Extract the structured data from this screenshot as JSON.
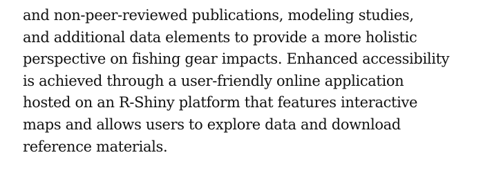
{
  "document": {
    "paragraph_lines": [
      "and non-peer-reviewed publications, modeling studies,",
      "and additional data elements to provide a more holistic",
      "perspective on fishing gear impacts. Enhanced accessibility",
      "is achieved through a user-friendly online application",
      "hosted on an R-Shiny platform that features interactive",
      "maps and allows users to explore data and download",
      "reference materials."
    ]
  }
}
